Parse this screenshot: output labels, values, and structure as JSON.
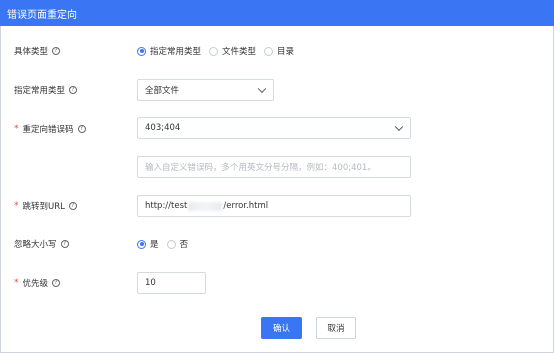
{
  "dialog": {
    "title": "错误页面重定向"
  },
  "form": {
    "type_label": "具体类型",
    "type_options": [
      "指定常用类型",
      "文件类型",
      "目录"
    ],
    "type_selected_index": 0,
    "common_type_label": "指定常用类型",
    "common_type_value": "全部文件",
    "code_label": "重定向错误码",
    "code_value": "403;404",
    "code_custom_placeholder": "输入自定义错误码，多个用英文分号分隔，例如：400;401。",
    "url_label": "跳转到URL",
    "url_prefix": "http://test",
    "url_suffix": "/error.html",
    "ignore_case_label": "忽略大小写",
    "ignore_case_options": [
      "是",
      "否"
    ],
    "ignore_case_selected_index": 0,
    "priority_label": "优先级",
    "priority_value": "10"
  },
  "buttons": {
    "confirm": "确认",
    "cancel": "取消"
  },
  "colors": {
    "accent": "#3a76f3",
    "required": "#e34b4b"
  },
  "icons": {
    "help": "question-circle-icon",
    "dropdown": "chevron-down-icon"
  }
}
